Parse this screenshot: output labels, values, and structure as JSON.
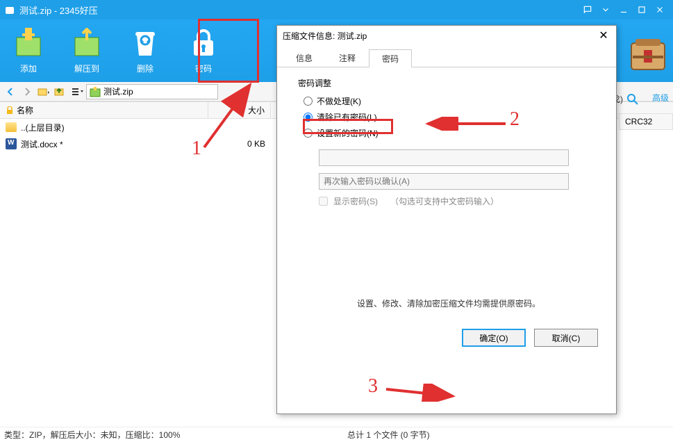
{
  "window": {
    "title": "测试.zip - 2345好压"
  },
  "toolbar": {
    "add": "添加",
    "extract": "解压到",
    "delete": "删除",
    "password": "密码"
  },
  "path": "测试.zip",
  "columns": {
    "name": "名称",
    "size": "大小",
    "crc": "CRC32"
  },
  "advanced_label": "高级",
  "close_paren": "戈)",
  "rows": [
    {
      "name": "..(上层目录)",
      "size": ""
    },
    {
      "name": "测试.docx *",
      "size": "0 KB"
    }
  ],
  "status": {
    "left": "类型：ZIP，解压后大小：未知，压缩比：100%",
    "right": "总计 1 个文件 (0 字节)"
  },
  "dialog": {
    "title": "压缩文件信息: 测试.zip",
    "tabs": {
      "info": "信息",
      "comment": "注释",
      "password": "密码"
    },
    "group_label": "密码调整",
    "radios": {
      "none": "不做处理(K)",
      "clear": "清除已有密码(L)",
      "set": "设置新的密码(N)"
    },
    "pwd2_placeholder": "再次输入密码以确认(A)",
    "show_pwd": "显示密码(S)",
    "show_hint": "（勾选可支持中文密码输入）",
    "note": "设置、修改、清除加密压缩文件均需提供原密码。",
    "ok": "确定(O)",
    "cancel": "取消(C)"
  },
  "annotations": {
    "one": "1",
    "two": "2",
    "three": "3"
  }
}
